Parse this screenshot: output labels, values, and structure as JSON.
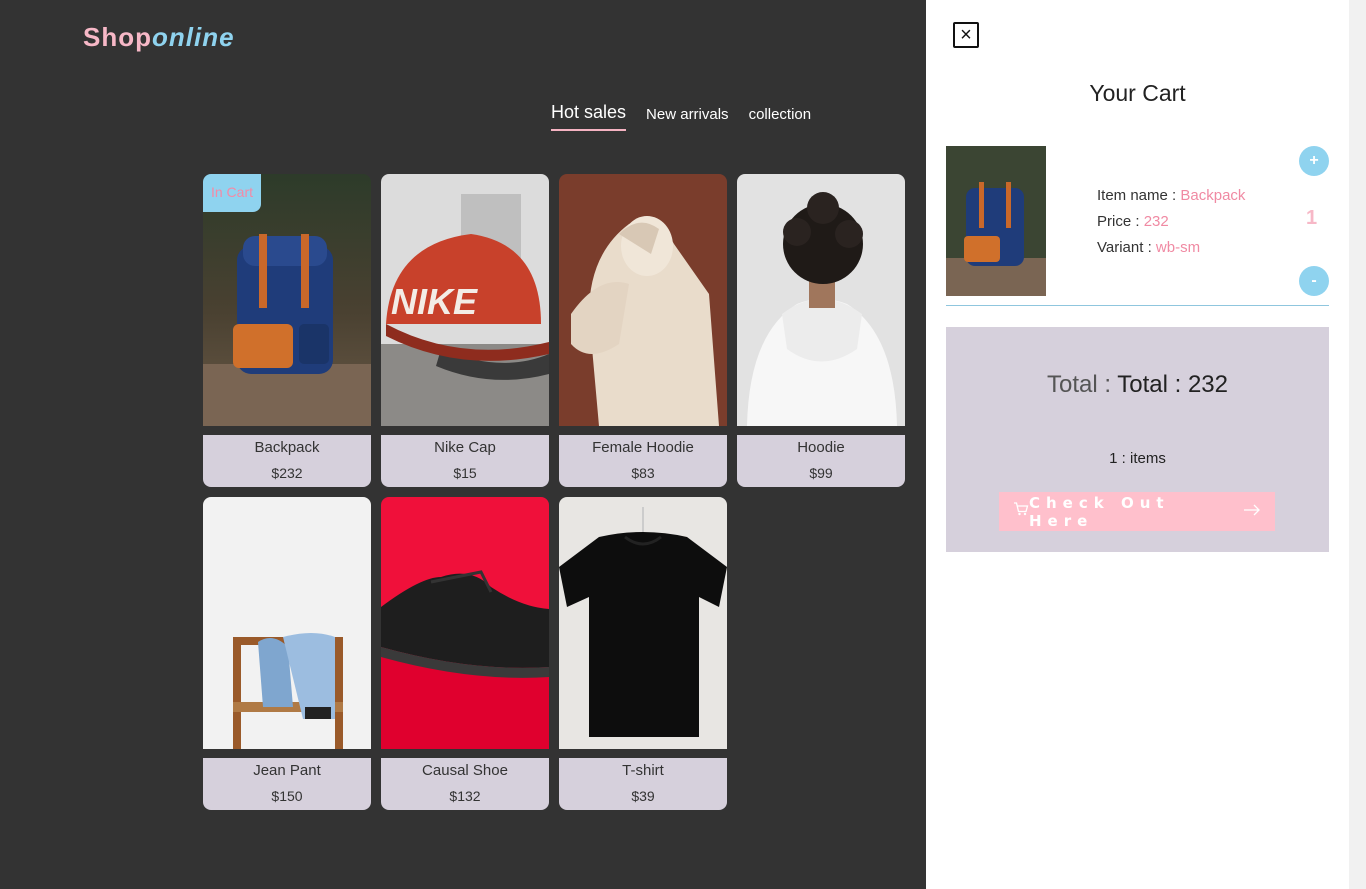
{
  "logo": {
    "part1": "Shop",
    "part2": "online"
  },
  "tabs": [
    {
      "label": "Hot sales"
    },
    {
      "label": "New arrivals"
    },
    {
      "label": "collection"
    }
  ],
  "products": [
    {
      "name": "Backpack",
      "price": "$232",
      "badge": "In Cart"
    },
    {
      "name": "Nike Cap",
      "price": "$15"
    },
    {
      "name": "Female Hoodie",
      "price": "$83"
    },
    {
      "name": "Hoodie",
      "price": "$99"
    },
    {
      "name": "Jean Pant",
      "price": "$150"
    },
    {
      "name": "Causal Shoe",
      "price": "$132"
    },
    {
      "name": "T-shirt",
      "price": "$39"
    }
  ],
  "cart": {
    "title": "Your Cart",
    "close_icon": "close-icon",
    "item": {
      "name_label": "Item name : ",
      "name": "Backpack",
      "price_label": "Price : ",
      "price": "232",
      "variant_label": "Variant : ",
      "variant": "wb-sm",
      "quantity": "1",
      "plus_label": "+",
      "minus_label": "-"
    },
    "total_label": "Total : ",
    "total_value": "Total : 232",
    "items_count": "1 : items",
    "checkout_label": "Check Out Here",
    "checkout_icons": [
      "cart-icon",
      "arrow-right-icon"
    ]
  },
  "colors": {
    "background": "#333333",
    "accent_pink": "#f7b8c7",
    "accent_blue": "#8fd3ef",
    "card_info": "#d6d0dc"
  }
}
